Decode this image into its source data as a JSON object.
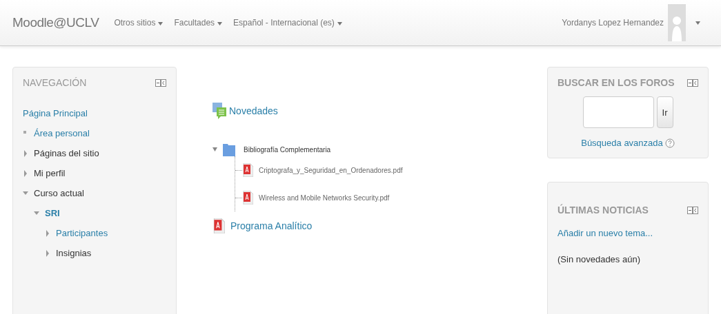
{
  "navbar": {
    "brand": "Moodle@UCLV",
    "menus": [
      {
        "label": "Otros sitios"
      },
      {
        "label": "Facultades"
      },
      {
        "label": "Español - Internacional (es)"
      }
    ],
    "user": "Yordanys Lopez Hernandez"
  },
  "navigation": {
    "title": "NAVEGACIÓN",
    "items": [
      {
        "label": "Página Principal",
        "kind": "root",
        "link": true
      },
      {
        "label": "Área personal",
        "kind": "leaf",
        "link": true
      },
      {
        "label": "Páginas del sitio",
        "kind": "branch",
        "expanded": false,
        "link": false
      },
      {
        "label": "Mi perfil",
        "kind": "branch",
        "expanded": false,
        "link": false
      },
      {
        "label": "Curso actual",
        "kind": "branch",
        "expanded": true,
        "link": false,
        "children": [
          {
            "label": "SRI",
            "kind": "branch",
            "expanded": true,
            "link": true,
            "bold": true,
            "children": [
              {
                "label": "Participantes",
                "kind": "branch",
                "expanded": false,
                "link": true
              },
              {
                "label": "Insignias",
                "kind": "branch",
                "expanded": false,
                "link": false
              }
            ]
          }
        ]
      }
    ]
  },
  "content": {
    "items": [
      {
        "kind": "forum",
        "label": "Novedades"
      },
      {
        "kind": "folder",
        "label": "Bibliografía Complementaria",
        "expanded": true,
        "children": [
          {
            "kind": "pdf",
            "label": "Criptografa_y_Seguridad_en_Ordenadores.pdf"
          },
          {
            "kind": "pdf",
            "label": "Wireless and Mobile Networks Security.pdf"
          }
        ]
      },
      {
        "kind": "pdf-link",
        "label": "Programa Analítico"
      }
    ]
  },
  "search_forums": {
    "title": "BUSCAR EN LOS FOROS",
    "button": "Ir",
    "advanced": "Búsqueda avanzada"
  },
  "latest_news": {
    "title": "ÚLTIMAS NOTICIAS",
    "add": "Añadir un nuevo tema...",
    "empty": "(Sin novedades aún)"
  }
}
